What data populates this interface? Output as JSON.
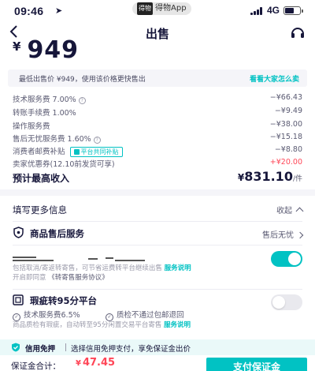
{
  "status_bar": {
    "time": "09:46",
    "app_pill_badge": "得物",
    "app_pill_label": "得物App",
    "network": "4G"
  },
  "nav": {
    "title": "出售"
  },
  "price": {
    "currency": "¥",
    "value": "949"
  },
  "hint": {
    "text": "最低出售价 ¥949，使用该价格更快售出",
    "link": "看看大家怎么卖"
  },
  "fees": [
    {
      "label": "技术服务费 7.00%",
      "value": "−¥66.43"
    },
    {
      "label": "转账手续费 1.00%",
      "value": "−¥9.49"
    },
    {
      "label": "操作服务费",
      "value": "−¥38.00"
    },
    {
      "label": "售后无忧服务费 1.60%",
      "value": "−¥15.18"
    },
    {
      "label": "消费者邮费补贴",
      "tag": "平台共同补贴",
      "value": "−¥8.80"
    },
    {
      "label": "卖家优惠券(12.10前发货可享)",
      "value": "+¥20.00",
      "positive": true
    }
  ],
  "income": {
    "label": "预计最高收入",
    "currency": "¥",
    "value": "831.10",
    "unit": "/件"
  },
  "more_info": {
    "label": "填写更多信息",
    "collapse": "收起"
  },
  "after_sale": {
    "label": "商品售后服务",
    "value": "售后无忧"
  },
  "consignment": {
    "desc_line1": "包括取消/寄返转寄售，可节省运费转平台继续出售",
    "link": "服务说明",
    "desc_line2": "开启即同意",
    "agreement": "《转寄售服务协议》",
    "enabled": true
  },
  "defect": {
    "label": "瑕疵转95分平台",
    "option1": "技术服务费6.5%",
    "option2": "质检不通过包邮退回",
    "desc": "商品质检有瑕疵，自动转至95分闲置交易平台寄售",
    "link": "服务说明",
    "enabled": false
  },
  "credit": {
    "label": "信用免押",
    "text": "选择信用免押支付，享免保证金出价"
  },
  "bottom": {
    "label": "保证金合计：",
    "currency": "¥",
    "amount": "47.45",
    "button": "支付保证金"
  },
  "colors": {
    "accent": "#01c2c3",
    "negative": "#ff4657",
    "text": "#16163a"
  }
}
